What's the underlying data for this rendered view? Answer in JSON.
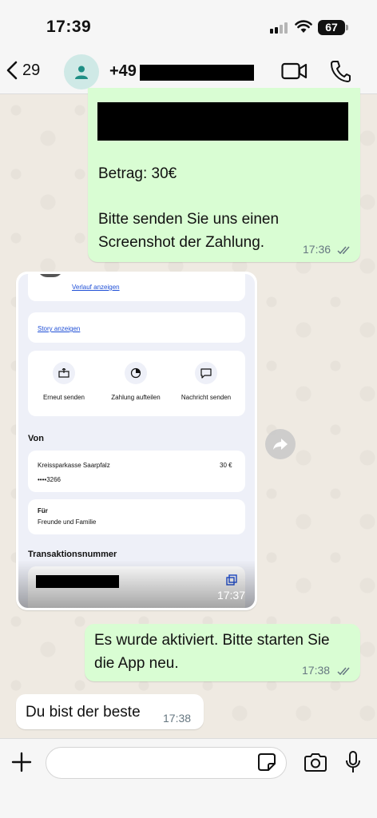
{
  "status_bar": {
    "time": "17:39",
    "battery": "67"
  },
  "header": {
    "back_count": "29",
    "contact_prefix": "+49"
  },
  "messages": {
    "m1": {
      "line1": "Betrag: 30€",
      "line2": "Bitte senden Sie uns einen",
      "line3": "Screenshot der Zahlung.",
      "time": "17:36"
    },
    "m2": {
      "time": "17:37",
      "screenshot": {
        "link_history": "Verlauf anzeigen",
        "link_story": "Story anzeigen",
        "actions": [
          "Erneut senden",
          "Zahlung aufteilen",
          "Nachricht senden"
        ],
        "from_title": "Von",
        "bank": "Kreissparkasse Saarpfalz",
        "amount": "30 €",
        "account": "••••3266",
        "for_label": "Für",
        "for_value": "Freunde und Familie",
        "tx_title": "Transaktionsnummer"
      }
    },
    "m3": {
      "line1": "Es wurde aktiviert. Bitte starten Sie",
      "line2": "die App neu.",
      "time": "17:38"
    },
    "m4": {
      "text": "Du bist der beste",
      "time": "17:38"
    }
  },
  "input": {
    "placeholder": ""
  },
  "colors": {
    "outgoing": "#d9fdd3",
    "incoming": "#ffffff",
    "background": "#efeae2",
    "link": "#1f4fd6"
  },
  "icons": [
    "back-chevron-icon",
    "contact-avatar-icon",
    "video-call-icon",
    "phone-icon",
    "double-check-icon",
    "forward-icon",
    "plus-icon",
    "sticker-icon",
    "camera-icon",
    "microphone-icon"
  ]
}
